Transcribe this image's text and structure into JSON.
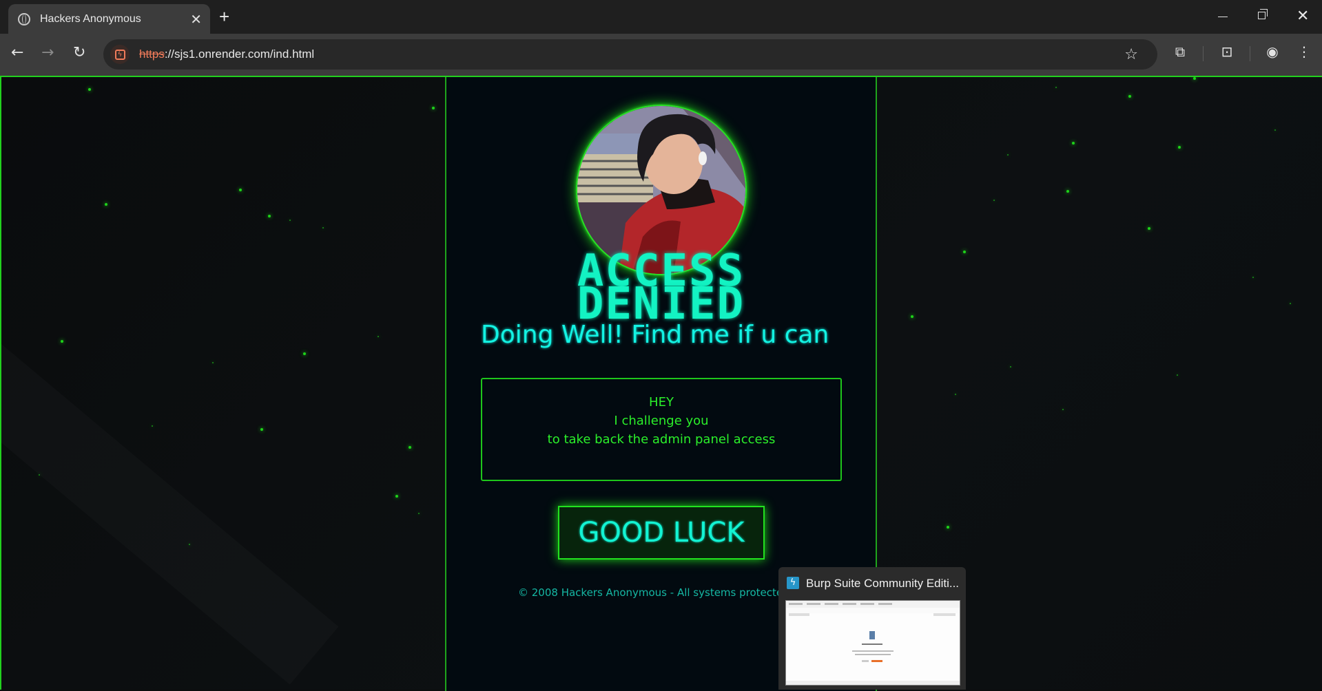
{
  "browser": {
    "tab_title": "Hackers Anonymous",
    "url_scheme": "https",
    "url_rest": "://sjs1.onrender.com/ind.html"
  },
  "page": {
    "title_line1": "ACCESS",
    "title_line2": "DENIED",
    "subtitle": "Doing Well! Find me if u can",
    "message": {
      "line1": "HEY",
      "line2": "I challenge you",
      "line3": "to take back the admin panel access"
    },
    "button_label": "GOOD LUCK",
    "footer": "© 2008 Hackers Anonymous - All systems protected",
    "accent_color": "#22d11e",
    "title_color": "#13f3c3"
  },
  "taskbar_preview": {
    "title": "Burp Suite Community Editi...",
    "icon": "burp-suite-icon"
  }
}
